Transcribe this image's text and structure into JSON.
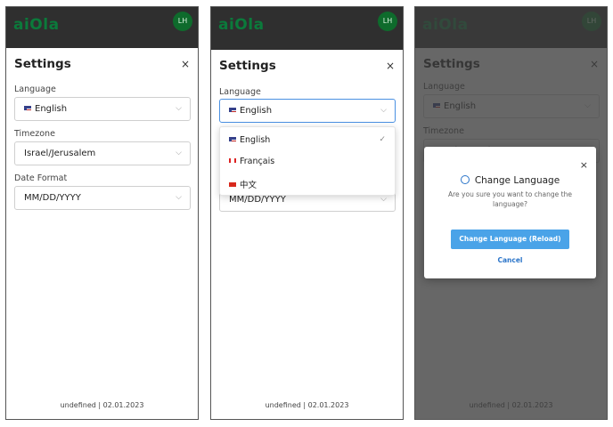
{
  "app": {
    "logo": "aiOla",
    "avatar_initials": "LH"
  },
  "settings": {
    "title": "Settings",
    "close_glyph": "×",
    "language": {
      "label": "Language",
      "value": "English"
    },
    "timezone": {
      "label": "Timezone",
      "value": "Israel/Jerusalem"
    },
    "date_format": {
      "label": "Date Format",
      "value": "MM/DD/YYYY"
    },
    "chevron_glyph": "⌵"
  },
  "footer": "undefined | 02.01.2023",
  "language_dropdown": {
    "options": [
      "English",
      "Français",
      "中文"
    ],
    "check_glyph": "✓"
  },
  "dialog": {
    "title": "Change Language",
    "message": "Are you sure you want to change the language?",
    "confirm_label": "Change Language (Reload)",
    "cancel_label": "Cancel",
    "close_glyph": "×"
  },
  "colors": {
    "brand": "#0b7a3b",
    "topbar": "#2f2f2f",
    "accent": "#4aa3e8",
    "link": "#2a74c9"
  },
  "icons": [
    "us-flag-icon",
    "canada-flag-icon",
    "china-flag-icon",
    "chevron-down-icon",
    "check-icon",
    "globe-icon",
    "close-icon"
  ]
}
